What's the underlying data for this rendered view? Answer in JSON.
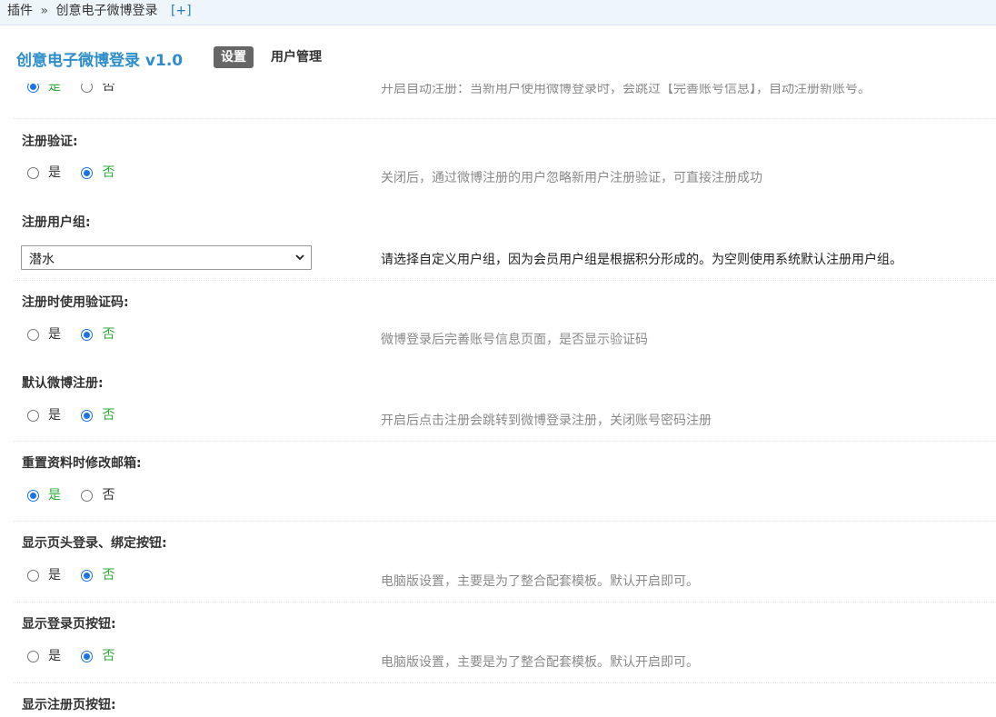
{
  "breadcrumb": {
    "root": "插件",
    "separator": "»",
    "current": "创意电子微博登录",
    "add": "[+]"
  },
  "header": {
    "plugin_title": "创意电子微博登录 v1.0",
    "tabs": [
      {
        "label": "设置",
        "active": true
      },
      {
        "label": "用户管理",
        "active": false
      }
    ]
  },
  "settings": {
    "auto_register": {
      "options": [
        "是",
        "否"
      ],
      "selected": "是",
      "desc": "开启自动注册：当新用户使用微博登录时，会跳过【完善账号信息】，自动注册新账号。"
    },
    "register_verify": {
      "label": "注册验证:",
      "options": [
        "是",
        "否"
      ],
      "selected": "否",
      "desc": "关闭后，通过微博注册的用户忽略新用户注册验证，可直接注册成功"
    },
    "register_group": {
      "label": "注册用户组:",
      "selected": "潜水",
      "desc": "请选择自定义用户组，因为会员用户组是根据积分形成的。为空则使用系统默认注册用户组。"
    },
    "register_captcha": {
      "label": "注册时使用验证码:",
      "options": [
        "是",
        "否"
      ],
      "selected": "否",
      "desc": "微博登录后完善账号信息页面，是否显示验证码"
    },
    "default_weibo_register": {
      "label": "默认微博注册:",
      "options": [
        "是",
        "否"
      ],
      "selected": "否",
      "desc": "开启后点击注册会跳转到微博登录注册，关闭账号密码注册"
    },
    "reset_email": {
      "label": "重置资料时修改邮箱:",
      "options": [
        "是",
        "否"
      ],
      "selected": "是",
      "desc": ""
    },
    "header_buttons": {
      "label": "显示页头登录、绑定按钮:",
      "options": [
        "是",
        "否"
      ],
      "selected": "否",
      "desc": "电脑版设置，主要是为了整合配套模板。默认开启即可。"
    },
    "login_page_button": {
      "label": "显示登录页按钮:",
      "options": [
        "是",
        "否"
      ],
      "selected": "否",
      "desc": "电脑版设置，主要是为了整合配套模板。默认开启即可。"
    },
    "register_page_button": {
      "label": "显示注册页按钮:"
    }
  },
  "colors": {
    "accent_title": "#2d8ec9",
    "radio_checked": "#1a73e8",
    "selected_text": "#2faa3a"
  }
}
